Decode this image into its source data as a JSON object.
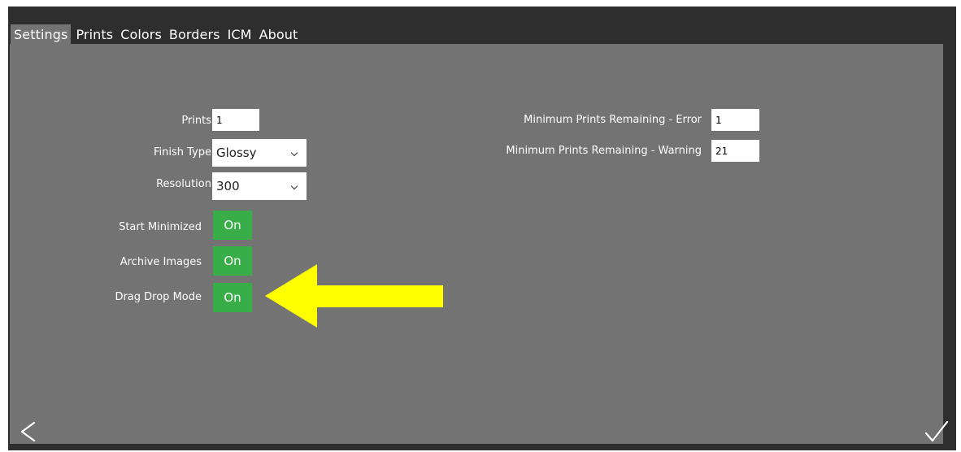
{
  "tabs": [
    {
      "label": "Settings",
      "active": true
    },
    {
      "label": "Prints",
      "active": false
    },
    {
      "label": "Colors",
      "active": false
    },
    {
      "label": "Borders",
      "active": false
    },
    {
      "label": "ICM",
      "active": false
    },
    {
      "label": "About",
      "active": false
    }
  ],
  "settings": {
    "prints": {
      "label": "Prints",
      "value": "1"
    },
    "finish_type": {
      "label": "Finish Type",
      "value": "Glossy"
    },
    "resolution": {
      "label": "Resolution",
      "value": "300"
    },
    "start_minimized": {
      "label": "Start Minimized",
      "value": "On"
    },
    "archive_images": {
      "label": "Archive Images",
      "value": "On"
    },
    "drag_drop_mode": {
      "label": "Drag Drop Mode",
      "value": "On"
    },
    "min_prints_error": {
      "label": "Minimum Prints Remaining - Error",
      "value": "1"
    },
    "min_prints_warning": {
      "label": "Minimum Prints Remaining - Warning",
      "value": "21"
    }
  },
  "icons": {
    "back": "chevron-left-icon",
    "confirm": "checkmark-icon",
    "annotation": "arrow-left-icon"
  },
  "colors": {
    "window_bg": "#2e2e2e",
    "panel_bg": "#737373",
    "toggle_on": "#38ad48",
    "annotation_arrow": "#ffff00"
  }
}
